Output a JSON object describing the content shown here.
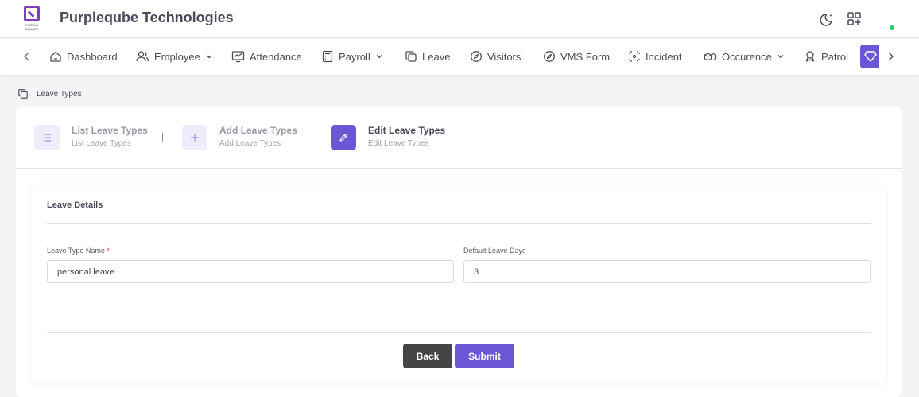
{
  "header": {
    "logo_text": "PURPLE SQUARE",
    "brand": "Purpleqube Technologies",
    "icons": [
      "moon-icon",
      "grid-plus-icon"
    ],
    "status_color": "#2ecc71"
  },
  "nav": {
    "items": [
      {
        "label": "Dashboard",
        "icon": "home-icon"
      },
      {
        "label": "Employee",
        "icon": "users-icon",
        "dropdown": true
      },
      {
        "label": "Attendance",
        "icon": "monitor-chart-icon"
      },
      {
        "label": "Payroll",
        "icon": "calculator-icon",
        "dropdown": true
      },
      {
        "label": "Leave",
        "icon": "copy-icon"
      },
      {
        "label": "Visitors",
        "icon": "compass-icon"
      },
      {
        "label": "VMS Form",
        "icon": "compass-icon"
      },
      {
        "label": "Incident",
        "icon": "focus-icon"
      },
      {
        "label": "Occurence",
        "icon": "boxes-icon",
        "dropdown": true
      },
      {
        "label": "Patrol",
        "icon": "badge-icon"
      }
    ],
    "accent": "#6a57d6"
  },
  "breadcrumb": {
    "label": "Leave Types"
  },
  "stepper": {
    "steps": [
      {
        "title": "List Leave Types",
        "subtitle": "List Leave Types",
        "icon": "list-icon"
      },
      {
        "title": "Add Leave Types",
        "subtitle": "Add Leave Types",
        "icon": "plus-icon"
      },
      {
        "title": "Edit Leave Types",
        "subtitle": "Edit Leave Types",
        "icon": "pencil-icon",
        "active": true
      }
    ]
  },
  "form": {
    "section_title": "Leave Details",
    "leave_type_label": "Leave Type Name",
    "required_mark": "*",
    "leave_type_value": "personal leave",
    "default_days_label": "Default Leave Days",
    "default_days_value": "3",
    "back_label": "Back",
    "submit_label": "Submit"
  }
}
